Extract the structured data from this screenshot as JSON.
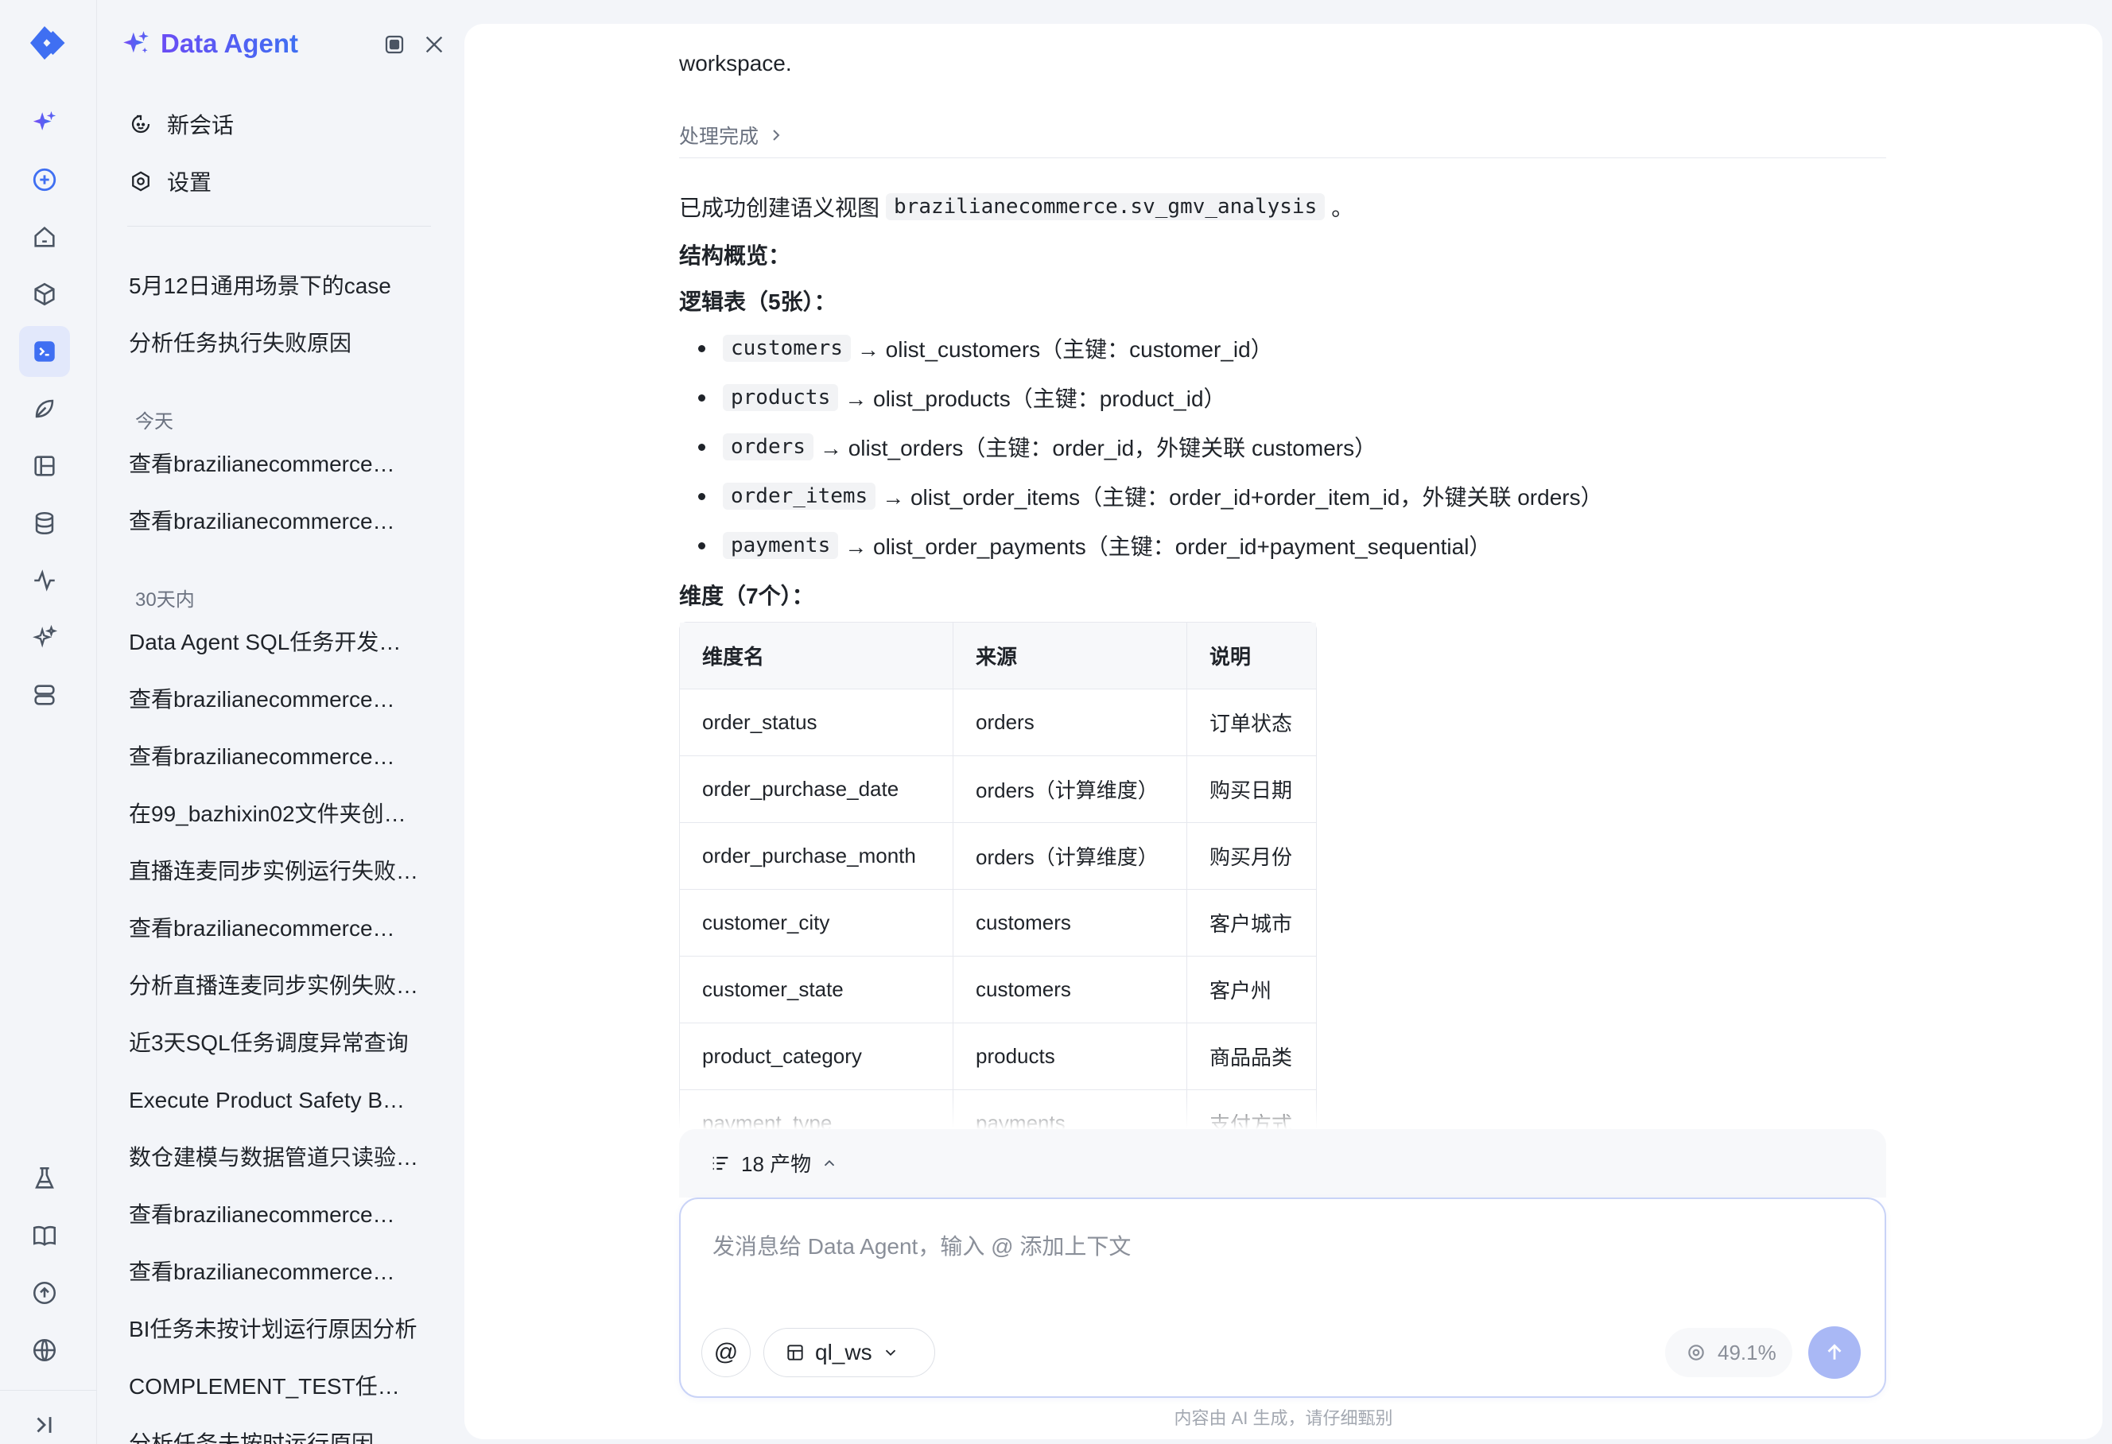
{
  "colors": {
    "accent": "#3f6ff2",
    "brand_purple": "#6a4cf4",
    "send_button": "#a9b8f5",
    "rail_active_bg": "#e2e8fb"
  },
  "rail": {
    "items": [
      "logo-icon",
      "sparkle-icon",
      "plus-circle-icon",
      "home-icon",
      "cube-icon",
      "terminal-icon",
      "leaf-icon",
      "book-grid-icon",
      "database-icon",
      "activity-icon",
      "stars-icon",
      "server-icon",
      "flask-icon",
      "book-icon",
      "upload-circle-icon",
      "globe-icon",
      "collapse-sidebar-icon"
    ],
    "active": "terminal-icon"
  },
  "panel": {
    "title": "Data Agent",
    "new_chat": "新会话",
    "settings": "设置",
    "pinned": [
      "5月12日通用场景下的case",
      "分析任务执行失败原因"
    ],
    "groups": [
      {
        "label": "今天",
        "items": [
          "查看brazilianecommerce…",
          "查看brazilianecommerce…"
        ]
      },
      {
        "label": "30天内",
        "items": [
          "Data Agent SQL任务开发…",
          "查看brazilianecommerce…",
          "查看brazilianecommerce…",
          "在99_bazhixin02文件夹创…",
          "直播连麦同步实例运行失败…",
          "查看brazilianecommerce…",
          "分析直播连麦同步实例失败…",
          "近3天SQL任务调度异常查询",
          "Execute Product Safety B…",
          "数仓建模与数据管道只读验…",
          "查看brazilianecommerce…",
          "查看brazilianecommerce…",
          "BI任务未按计划运行原因分析",
          "COMPLEMENT_TEST任…",
          "分析任务未按时运行原因"
        ]
      }
    ]
  },
  "main": {
    "workspace_fragment": "workspace.",
    "status": "处理完成",
    "success_prefix": "已成功创建语义视图",
    "success_code": "brazilianecommerce.sv_gmv_analysis",
    "success_suffix": "。",
    "structure_heading": "结构概览：",
    "logical_tables_heading": "逻辑表（5张）：",
    "logical_tables": [
      {
        "code": "customers",
        "text": "→ olist_customers（主键：customer_id）"
      },
      {
        "code": "products",
        "text": "→ olist_products（主键：product_id）"
      },
      {
        "code": "orders",
        "text": "→ olist_orders（主键：order_id，外键关联 customers）"
      },
      {
        "code": "order_items",
        "text": "→ olist_order_items（主键：order_id+order_item_id，外键关联 orders）"
      },
      {
        "code": "payments",
        "text": "→ olist_order_payments（主键：order_id+payment_sequential）"
      }
    ],
    "dimensions_heading": "维度（7个）：",
    "dim_table": {
      "headers": [
        "维度名",
        "来源",
        "说明"
      ],
      "rows": [
        [
          "order_status",
          "orders",
          "订单状态"
        ],
        [
          "order_purchase_date",
          "orders（计算维度）",
          "购买日期"
        ],
        [
          "order_purchase_month",
          "orders（计算维度）",
          "购买月份"
        ],
        [
          "customer_city",
          "customers",
          "客户城市"
        ],
        [
          "customer_state",
          "customers",
          "客户州"
        ],
        [
          "product_category",
          "products",
          "商品品类"
        ],
        [
          "payment_type",
          "payments",
          "支付方式"
        ]
      ]
    },
    "artifacts_label": "18 产物",
    "input_placeholder": "发消息给 Data Agent，输入 @ 添加上下文",
    "at_label": "@",
    "workspace_select": "ql_ws",
    "context_usage": "49.1%",
    "disclaimer": "内容由 AI 生成，请仔细甄别"
  }
}
